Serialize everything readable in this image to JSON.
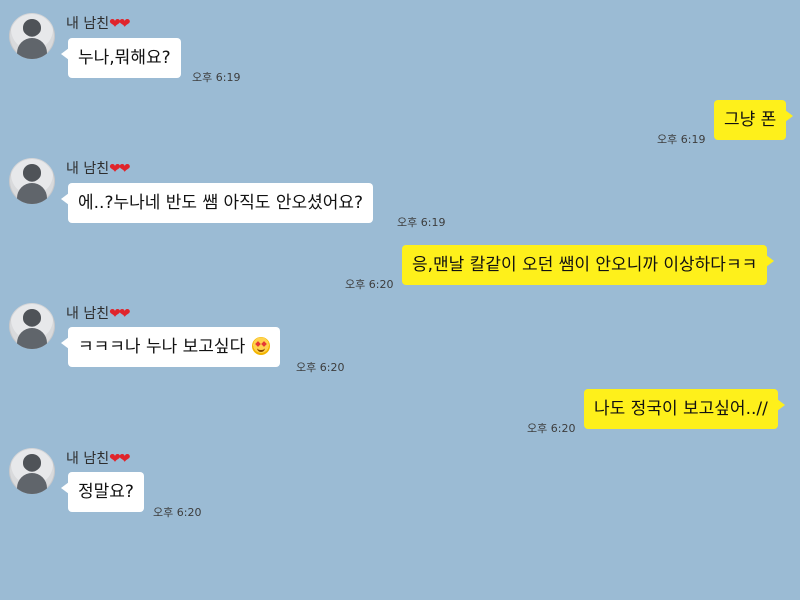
{
  "contact": {
    "name": "내 남친",
    "hearts": "❤❤"
  },
  "messages": [
    {
      "side": "left",
      "text": "누나,뭐해요?",
      "time": "오후 6:19"
    },
    {
      "side": "right",
      "text": "그냥 폰",
      "time": "오후 6:19"
    },
    {
      "side": "left",
      "text": "에..?누나네 반도 쌤 아직도 안오셨어요?",
      "time": "오후 6:19"
    },
    {
      "side": "right",
      "text": "응,맨날 칼같이 오던 쌤이 안오니까 이상하다ㅋㅋ",
      "time": "오후 6:20"
    },
    {
      "side": "left",
      "text": "ㅋㅋㅋ나 누나 보고싶다",
      "emoji": "heart-eyes",
      "time": "오후 6:20"
    },
    {
      "side": "right",
      "text": "나도 정국이 보고싶어..//",
      "time": "오후 6:20"
    },
    {
      "side": "left",
      "text": "정말요?",
      "time": "오후 6:20"
    }
  ],
  "colors": {
    "background": "#9bbbd4",
    "incoming_bubble": "#ffffff",
    "outgoing_bubble": "#fef01b",
    "heart": "#e0242b"
  },
  "icons": {
    "avatar": "profile-photo-avatar",
    "heart": "heart-icon",
    "emoji": "heart-eyes-emoji-icon"
  }
}
